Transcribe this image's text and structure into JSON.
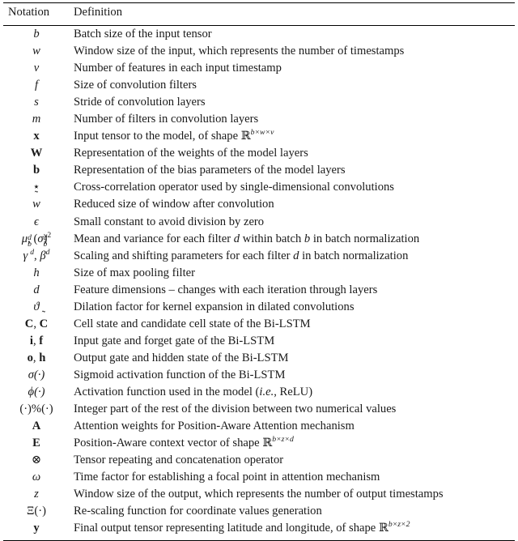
{
  "table": {
    "caption_present": false,
    "headers": {
      "notation": "Notation",
      "definition": "Definition"
    },
    "rows": [
      {
        "notation": "b",
        "definition": "Batch size of the input tensor"
      },
      {
        "notation": "w",
        "definition": "Window size of the input, which represents the number of timestamps"
      },
      {
        "notation": "v",
        "definition": "Number of features in each input timestamp"
      },
      {
        "notation": "f",
        "definition": "Size of convolution filters"
      },
      {
        "notation": "s",
        "definition": "Stride of convolution layers"
      },
      {
        "notation": "m",
        "definition": "Number of filters in convolution layers"
      },
      {
        "notation": "x",
        "definition": "Input tensor to the model, of shape R^{b×w×v}"
      },
      {
        "notation": "W",
        "definition": "Representation of the weights of the model layers"
      },
      {
        "notation": "b (bold)",
        "definition": "Representation of the bias parameters of the model layers"
      },
      {
        "notation": "⋆",
        "definition": "Cross-correlation operator used by single-dimensional convolutions"
      },
      {
        "notation": "w̃",
        "definition": "Reduced size of window after convolution"
      },
      {
        "notation": "ϵ",
        "definition": "Small constant to avoid division by zero"
      },
      {
        "notation": "μ_b^d, (σ_b^d)²",
        "definition": "Mean and variance for each filter d within batch b in batch normalization"
      },
      {
        "notation": "γ^d, β^d",
        "definition": "Scaling and shifting parameters for each filter d in batch normalization"
      },
      {
        "notation": "h",
        "definition": "Size of max pooling filter"
      },
      {
        "notation": "d",
        "definition": "Feature dimensions – changes with each iteration through layers"
      },
      {
        "notation": "ϑ",
        "definition": "Dilation factor for kernel expansion in dilated convolutions"
      },
      {
        "notation": "C, C̃",
        "definition": "Cell state and candidate cell state of the Bi-LSTM"
      },
      {
        "notation": "i, f",
        "definition": "Input gate and forget gate of the Bi-LSTM"
      },
      {
        "notation": "o, h",
        "definition": "Output gate and hidden state of the Bi-LSTM"
      },
      {
        "notation": "σ(·)",
        "definition": "Sigmoid activation function of the Bi-LSTM"
      },
      {
        "notation": "φ(·)",
        "definition": "Activation function used in the model (i.e., ReLU)"
      },
      {
        "notation": "(·)%(·)",
        "definition": "Integer part of the rest of the division between two numerical values"
      },
      {
        "notation": "A",
        "definition": "Attention weights for Position-Aware Attention mechanism"
      },
      {
        "notation": "E",
        "definition": "Position-Aware context vector of shape R^{b×z×d}"
      },
      {
        "notation": "⊗",
        "definition": "Tensor repeating and concatenation operator"
      },
      {
        "notation": "ω",
        "definition": "Time factor for establishing a focal point in attention mechanism"
      },
      {
        "notation": "z",
        "definition": "Window size of the output, which represents the number of output timestamps"
      },
      {
        "notation": "Ξ(·)",
        "definition": "Re-scaling function for coordinate values generation"
      },
      {
        "notation": "y",
        "definition": "Final output tensor representing latitude and longitude, of shape R^{b×z×2}"
      }
    ],
    "definitions_plain": {
      "r0": "Batch size of the input tensor",
      "r1": "Window size of the input, which represents the number of timestamps",
      "r2": "Number of features in each input timestamp",
      "r3": "Size of convolution filters",
      "r4": "Stride of convolution layers",
      "r5": "Number of filters in convolution layers",
      "r6_pre": "Input tensor to the model, of shape",
      "r7": "Representation of the weights of the model layers",
      "r8": "Representation of the bias parameters of the model layers",
      "r9": "Cross-correlation operator used by single-dimensional convolutions",
      "r10": "Reduced size of window after convolution",
      "r11": "Small constant to avoid division by zero",
      "r12a": "Mean and variance for each filter",
      "r12b": "within batch",
      "r12c": "in batch normalization",
      "r13a": "Scaling and shifting parameters for each filter",
      "r13b": "in batch normalization",
      "r14": "Size of max pooling filter",
      "r15": "Feature dimensions – changes with each iteration through layers",
      "r16": "Dilation factor for kernel expansion in dilated convolutions",
      "r17": "Cell state and candidate cell state of the Bi-LSTM",
      "r18": "Input gate and forget gate of the Bi-LSTM",
      "r19": "Output gate and hidden state of the Bi-LSTM",
      "r20": "Sigmoid activation function of the Bi-LSTM",
      "r21a": "Activation function used in the model (",
      "r21b": "i.e.",
      "r21c": ", ReLU)",
      "r22": "Integer part of the rest of the division between two numerical values",
      "r23": "Attention weights for Position-Aware Attention mechanism",
      "r24_pre": "Position-Aware context vector of shape",
      "r25": "Tensor repeating and concatenation operator",
      "r26": "Time factor for establishing a focal point in attention mechanism",
      "r27": "Window size of the output, which represents the number of output timestamps",
      "r28": "Re-scaling function for coordinate values generation",
      "r29_pre": "Final output tensor representing latitude and longitude, of shape"
    },
    "symbols": {
      "blackboard_R": "R",
      "shape_x": "b×w×v",
      "shape_E": "b×z×d",
      "shape_y": "b×z×2",
      "star": "⋆",
      "epsilon": "ϵ",
      "mu": "μ",
      "sigma_lower": "σ",
      "gamma": "γ",
      "beta": "β",
      "vartheta": "ϑ",
      "sigma_fn": "σ(·)",
      "phi_fn": "ϕ(·)",
      "mod_fn": "(·)%(·)",
      "otimes": "⊗",
      "omega": "ω",
      "Xi_fn": "Ξ(·)",
      "letter_b": "b",
      "letter_w": "w",
      "letter_v": "v",
      "letter_f": "f",
      "letter_s": "s",
      "letter_m": "m",
      "letter_x": "x",
      "letter_W": "W",
      "letter_h": "h",
      "letter_d": "d",
      "letter_C": "C",
      "letter_i": "i",
      "letter_o": "o",
      "letter_A": "A",
      "letter_E": "E",
      "letter_z": "z",
      "letter_y": "y",
      "comma": ",",
      "sup_d": "d",
      "sub_b": "b",
      "sup_2": "2"
    }
  },
  "colors": {
    "text": "#1a1a1a",
    "rule": "#000000",
    "background": "#ffffff"
  }
}
